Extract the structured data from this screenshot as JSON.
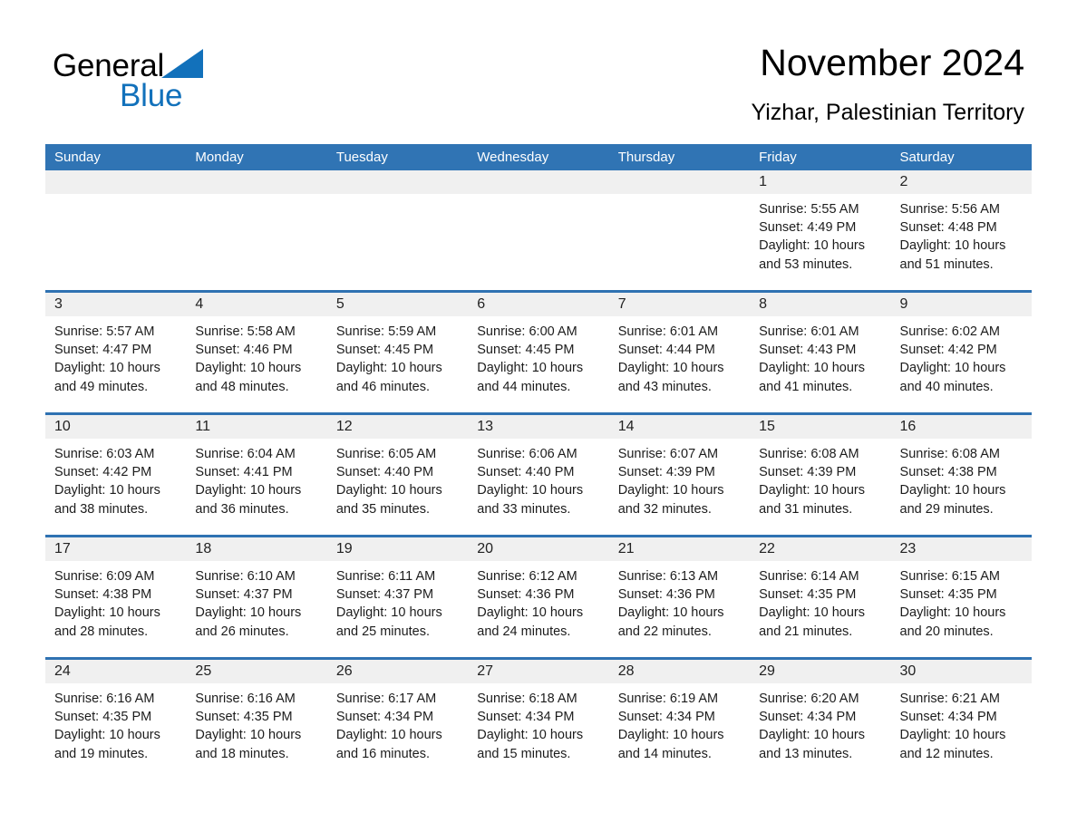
{
  "brand": {
    "name_part1": "General",
    "name_part2": "Blue",
    "triangle_color": "#1271bb"
  },
  "header": {
    "title": "November 2024",
    "location": "Yizhar, Palestinian Territory",
    "accent_color": "#3074b4"
  },
  "weekdays": [
    "Sunday",
    "Monday",
    "Tuesday",
    "Wednesday",
    "Thursday",
    "Friday",
    "Saturday"
  ],
  "weeks": [
    [
      {
        "day": "",
        "sunrise": "",
        "sunset": "",
        "daylight1": "",
        "daylight2": ""
      },
      {
        "day": "",
        "sunrise": "",
        "sunset": "",
        "daylight1": "",
        "daylight2": ""
      },
      {
        "day": "",
        "sunrise": "",
        "sunset": "",
        "daylight1": "",
        "daylight2": ""
      },
      {
        "day": "",
        "sunrise": "",
        "sunset": "",
        "daylight1": "",
        "daylight2": ""
      },
      {
        "day": "",
        "sunrise": "",
        "sunset": "",
        "daylight1": "",
        "daylight2": ""
      },
      {
        "day": "1",
        "sunrise": "Sunrise: 5:55 AM",
        "sunset": "Sunset: 4:49 PM",
        "daylight1": "Daylight: 10 hours",
        "daylight2": "and 53 minutes."
      },
      {
        "day": "2",
        "sunrise": "Sunrise: 5:56 AM",
        "sunset": "Sunset: 4:48 PM",
        "daylight1": "Daylight: 10 hours",
        "daylight2": "and 51 minutes."
      }
    ],
    [
      {
        "day": "3",
        "sunrise": "Sunrise: 5:57 AM",
        "sunset": "Sunset: 4:47 PM",
        "daylight1": "Daylight: 10 hours",
        "daylight2": "and 49 minutes."
      },
      {
        "day": "4",
        "sunrise": "Sunrise: 5:58 AM",
        "sunset": "Sunset: 4:46 PM",
        "daylight1": "Daylight: 10 hours",
        "daylight2": "and 48 minutes."
      },
      {
        "day": "5",
        "sunrise": "Sunrise: 5:59 AM",
        "sunset": "Sunset: 4:45 PM",
        "daylight1": "Daylight: 10 hours",
        "daylight2": "and 46 minutes."
      },
      {
        "day": "6",
        "sunrise": "Sunrise: 6:00 AM",
        "sunset": "Sunset: 4:45 PM",
        "daylight1": "Daylight: 10 hours",
        "daylight2": "and 44 minutes."
      },
      {
        "day": "7",
        "sunrise": "Sunrise: 6:01 AM",
        "sunset": "Sunset: 4:44 PM",
        "daylight1": "Daylight: 10 hours",
        "daylight2": "and 43 minutes."
      },
      {
        "day": "8",
        "sunrise": "Sunrise: 6:01 AM",
        "sunset": "Sunset: 4:43 PM",
        "daylight1": "Daylight: 10 hours",
        "daylight2": "and 41 minutes."
      },
      {
        "day": "9",
        "sunrise": "Sunrise: 6:02 AM",
        "sunset": "Sunset: 4:42 PM",
        "daylight1": "Daylight: 10 hours",
        "daylight2": "and 40 minutes."
      }
    ],
    [
      {
        "day": "10",
        "sunrise": "Sunrise: 6:03 AM",
        "sunset": "Sunset: 4:42 PM",
        "daylight1": "Daylight: 10 hours",
        "daylight2": "and 38 minutes."
      },
      {
        "day": "11",
        "sunrise": "Sunrise: 6:04 AM",
        "sunset": "Sunset: 4:41 PM",
        "daylight1": "Daylight: 10 hours",
        "daylight2": "and 36 minutes."
      },
      {
        "day": "12",
        "sunrise": "Sunrise: 6:05 AM",
        "sunset": "Sunset: 4:40 PM",
        "daylight1": "Daylight: 10 hours",
        "daylight2": "and 35 minutes."
      },
      {
        "day": "13",
        "sunrise": "Sunrise: 6:06 AM",
        "sunset": "Sunset: 4:40 PM",
        "daylight1": "Daylight: 10 hours",
        "daylight2": "and 33 minutes."
      },
      {
        "day": "14",
        "sunrise": "Sunrise: 6:07 AM",
        "sunset": "Sunset: 4:39 PM",
        "daylight1": "Daylight: 10 hours",
        "daylight2": "and 32 minutes."
      },
      {
        "day": "15",
        "sunrise": "Sunrise: 6:08 AM",
        "sunset": "Sunset: 4:39 PM",
        "daylight1": "Daylight: 10 hours",
        "daylight2": "and 31 minutes."
      },
      {
        "day": "16",
        "sunrise": "Sunrise: 6:08 AM",
        "sunset": "Sunset: 4:38 PM",
        "daylight1": "Daylight: 10 hours",
        "daylight2": "and 29 minutes."
      }
    ],
    [
      {
        "day": "17",
        "sunrise": "Sunrise: 6:09 AM",
        "sunset": "Sunset: 4:38 PM",
        "daylight1": "Daylight: 10 hours",
        "daylight2": "and 28 minutes."
      },
      {
        "day": "18",
        "sunrise": "Sunrise: 6:10 AM",
        "sunset": "Sunset: 4:37 PM",
        "daylight1": "Daylight: 10 hours",
        "daylight2": "and 26 minutes."
      },
      {
        "day": "19",
        "sunrise": "Sunrise: 6:11 AM",
        "sunset": "Sunset: 4:37 PM",
        "daylight1": "Daylight: 10 hours",
        "daylight2": "and 25 minutes."
      },
      {
        "day": "20",
        "sunrise": "Sunrise: 6:12 AM",
        "sunset": "Sunset: 4:36 PM",
        "daylight1": "Daylight: 10 hours",
        "daylight2": "and 24 minutes."
      },
      {
        "day": "21",
        "sunrise": "Sunrise: 6:13 AM",
        "sunset": "Sunset: 4:36 PM",
        "daylight1": "Daylight: 10 hours",
        "daylight2": "and 22 minutes."
      },
      {
        "day": "22",
        "sunrise": "Sunrise: 6:14 AM",
        "sunset": "Sunset: 4:35 PM",
        "daylight1": "Daylight: 10 hours",
        "daylight2": "and 21 minutes."
      },
      {
        "day": "23",
        "sunrise": "Sunrise: 6:15 AM",
        "sunset": "Sunset: 4:35 PM",
        "daylight1": "Daylight: 10 hours",
        "daylight2": "and 20 minutes."
      }
    ],
    [
      {
        "day": "24",
        "sunrise": "Sunrise: 6:16 AM",
        "sunset": "Sunset: 4:35 PM",
        "daylight1": "Daylight: 10 hours",
        "daylight2": "and 19 minutes."
      },
      {
        "day": "25",
        "sunrise": "Sunrise: 6:16 AM",
        "sunset": "Sunset: 4:35 PM",
        "daylight1": "Daylight: 10 hours",
        "daylight2": "and 18 minutes."
      },
      {
        "day": "26",
        "sunrise": "Sunrise: 6:17 AM",
        "sunset": "Sunset: 4:34 PM",
        "daylight1": "Daylight: 10 hours",
        "daylight2": "and 16 minutes."
      },
      {
        "day": "27",
        "sunrise": "Sunrise: 6:18 AM",
        "sunset": "Sunset: 4:34 PM",
        "daylight1": "Daylight: 10 hours",
        "daylight2": "and 15 minutes."
      },
      {
        "day": "28",
        "sunrise": "Sunrise: 6:19 AM",
        "sunset": "Sunset: 4:34 PM",
        "daylight1": "Daylight: 10 hours",
        "daylight2": "and 14 minutes."
      },
      {
        "day": "29",
        "sunrise": "Sunrise: 6:20 AM",
        "sunset": "Sunset: 4:34 PM",
        "daylight1": "Daylight: 10 hours",
        "daylight2": "and 13 minutes."
      },
      {
        "day": "30",
        "sunrise": "Sunrise: 6:21 AM",
        "sunset": "Sunset: 4:34 PM",
        "daylight1": "Daylight: 10 hours",
        "daylight2": "and 12 minutes."
      }
    ]
  ]
}
